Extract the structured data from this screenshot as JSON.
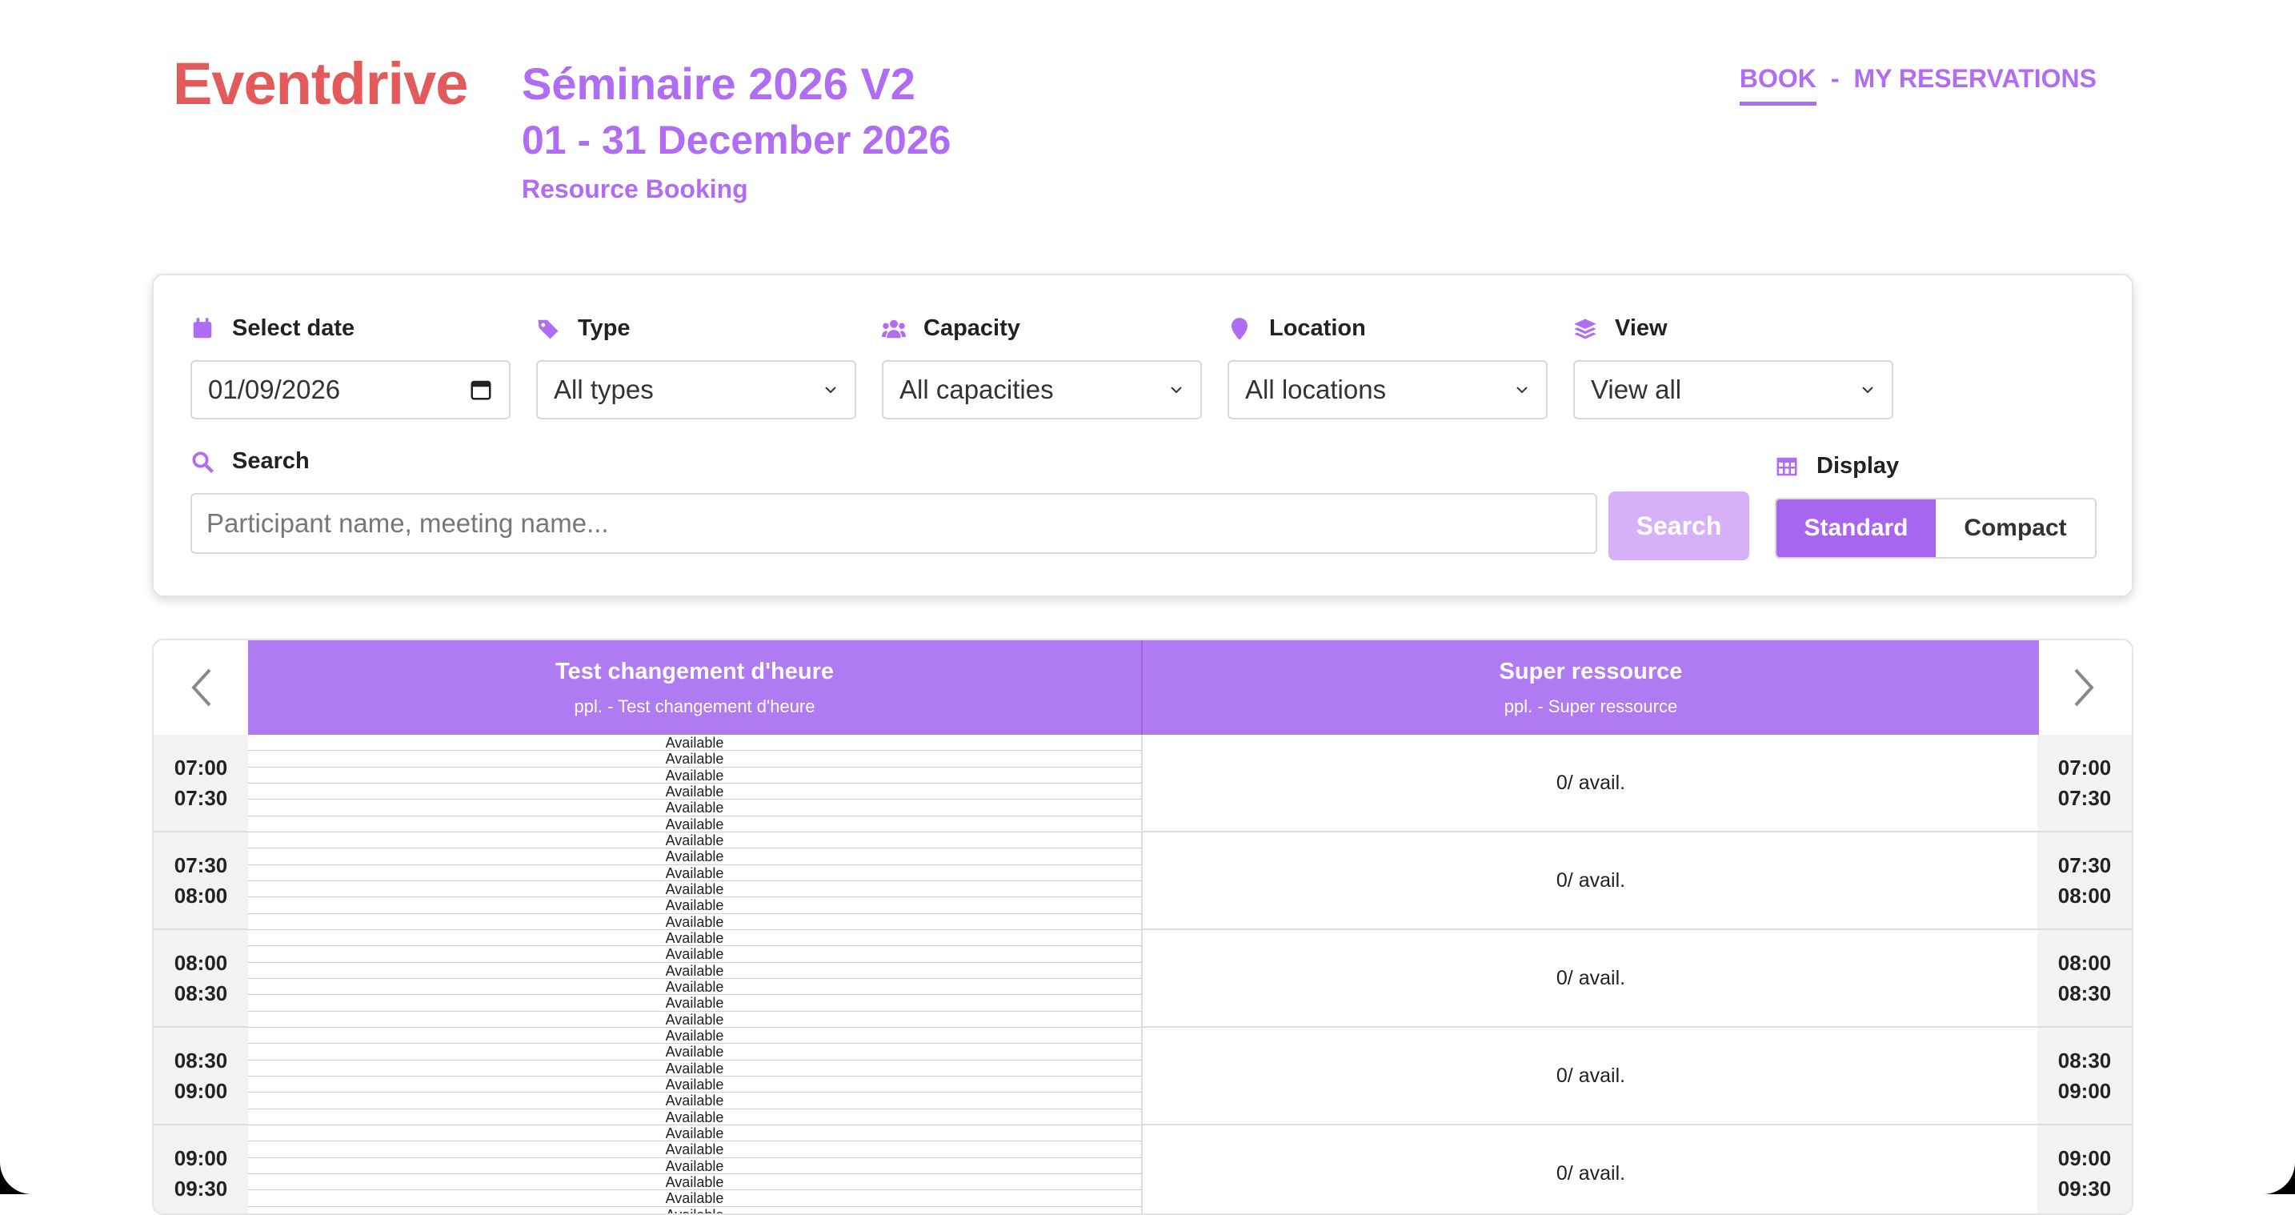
{
  "header": {
    "logo": "Eventdrive",
    "event_title": "Séminaire 2026 V2",
    "event_dates": "01 - 31 December 2026",
    "subtitle": "Resource Booking",
    "nav": {
      "book": "BOOK",
      "separator": "-",
      "reservations": "MY RESERVATIONS"
    }
  },
  "filters": {
    "date": {
      "label": "Select date",
      "value": "01/09/2026",
      "icon": "calendar-icon"
    },
    "type": {
      "label": "Type",
      "value": "All types",
      "icon": "tag-icon"
    },
    "capacity": {
      "label": "Capacity",
      "value": "All capacities",
      "icon": "users-icon"
    },
    "location": {
      "label": "Location",
      "value": "All locations",
      "icon": "location-pin-icon"
    },
    "view": {
      "label": "View",
      "value": "View all",
      "icon": "layers-icon"
    },
    "search": {
      "label": "Search",
      "placeholder": "Participant name, meeting name...",
      "button": "Search",
      "icon": "search-icon"
    },
    "display": {
      "label": "Display",
      "standard": "Standard",
      "compact": "Compact",
      "icon": "table-icon"
    }
  },
  "colors": {
    "brand": "#e35a5a",
    "accent": "#b06cf2",
    "header_bg": "#b07af2",
    "button_disabled": "#d6b1f8"
  },
  "grid": {
    "resources": [
      {
        "name": "Test changement d'heure",
        "meta": "ppl. - Test changement d'heure"
      },
      {
        "name": "Super ressource",
        "meta": "ppl. - Super ressource"
      }
    ],
    "slots": [
      {
        "start": "07:00",
        "end": "07:30",
        "sub": [
          "Available",
          "Available",
          "Available",
          "Available",
          "Available",
          "Available"
        ],
        "avail": "0/ avail."
      },
      {
        "start": "07:30",
        "end": "08:00",
        "sub": [
          "Available",
          "Available",
          "Available",
          "Available",
          "Available",
          "Available"
        ],
        "avail": "0/ avail."
      },
      {
        "start": "08:00",
        "end": "08:30",
        "sub": [
          "Available",
          "Available",
          "Available",
          "Available",
          "Available",
          "Available"
        ],
        "avail": "0/ avail."
      },
      {
        "start": "08:30",
        "end": "09:00",
        "sub": [
          "Available",
          "Available",
          "Available",
          "Available",
          "Available",
          "Available"
        ],
        "avail": "0/ avail."
      },
      {
        "start": "09:00",
        "end": "09:30",
        "sub": [
          "Available",
          "Available",
          "Available",
          "Available",
          "Available",
          "Available"
        ],
        "avail": "0/ avail."
      }
    ]
  }
}
